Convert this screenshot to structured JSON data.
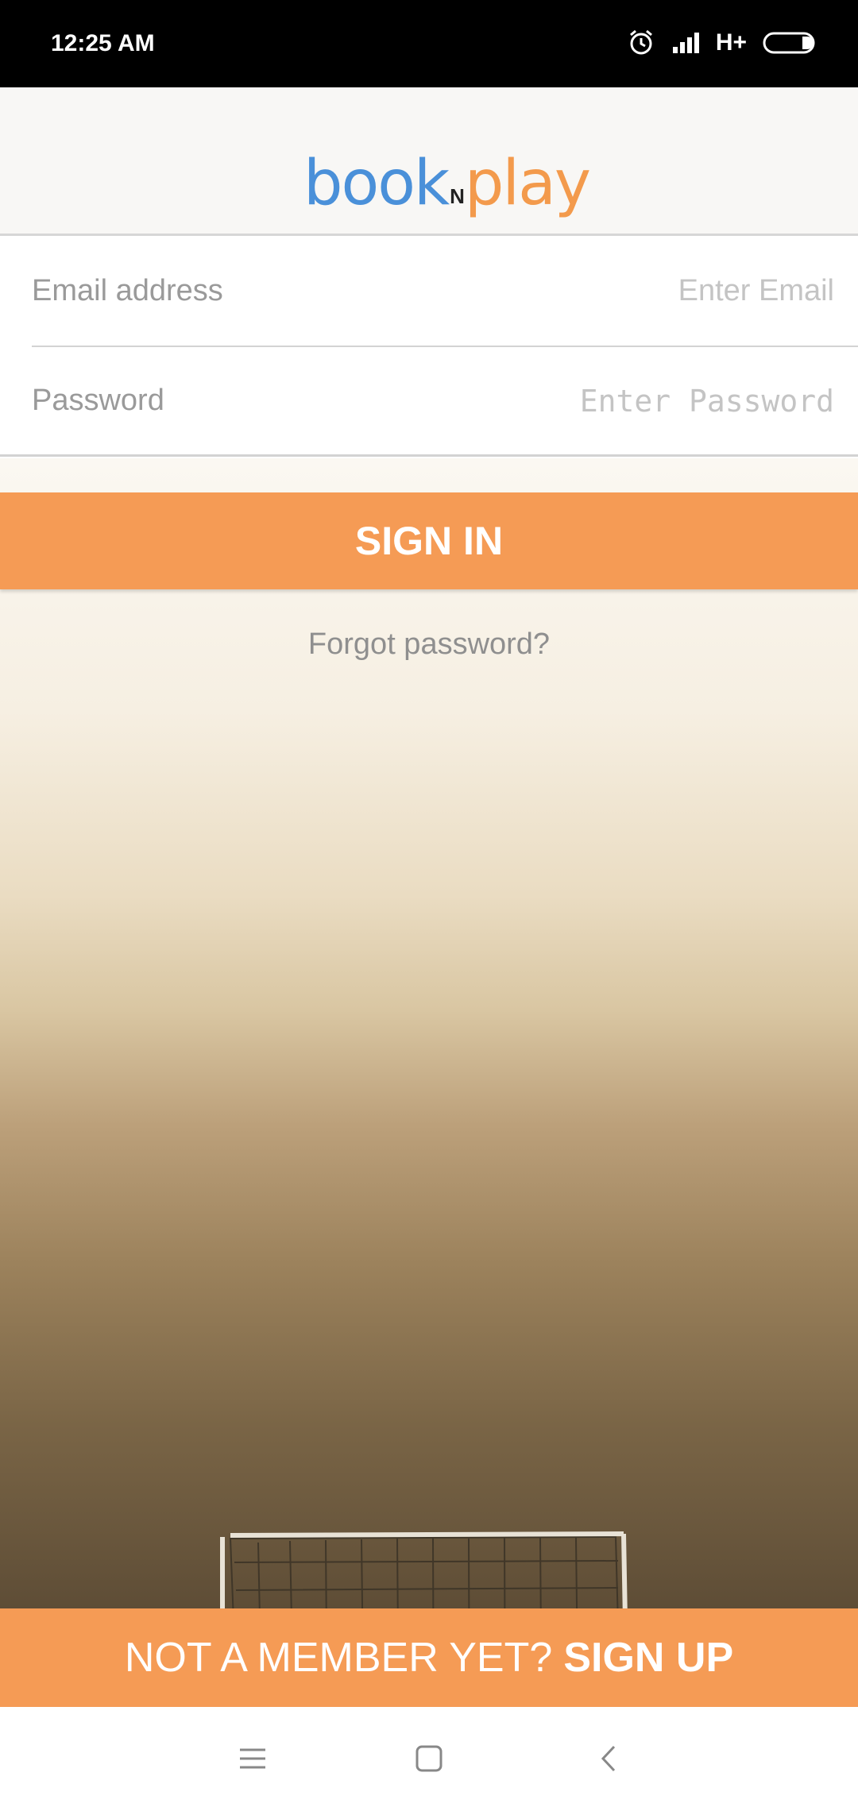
{
  "status_bar": {
    "time": "12:25 AM",
    "network": "H+",
    "icons": [
      "alarm-icon",
      "signal-icon",
      "battery-icon"
    ]
  },
  "logo": {
    "part1": "book",
    "part2": "N",
    "part3": "play"
  },
  "form": {
    "email": {
      "label": "Email address",
      "placeholder": "Enter Email"
    },
    "password": {
      "label": "Password",
      "placeholder": "Enter Password"
    }
  },
  "actions": {
    "signin_label": "SIGN IN",
    "forgot_label": "Forgot password?"
  },
  "signup": {
    "prompt": "NOT A MEMBER YET?",
    "cta": "SIGN UP"
  },
  "colors": {
    "accent": "#f59b55",
    "logo_blue": "#4a90d9"
  },
  "nav": {
    "icons": [
      "menu-icon",
      "home-icon",
      "back-icon"
    ]
  }
}
